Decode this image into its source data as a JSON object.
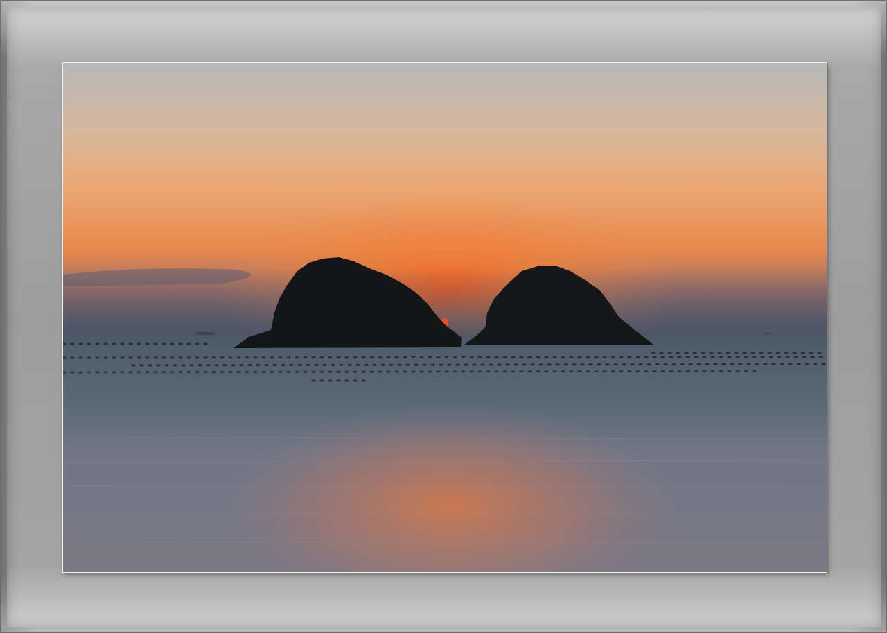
{
  "scene": {
    "subject": "two-islands-sunset",
    "colors": {
      "sky_top": "#b7b6b3",
      "sky_mid": "#e8b082",
      "sky_glow": "#f0752a",
      "sky_haze": "#5b5f72",
      "sea_far": "#4f5e6d",
      "sea_near": "#7a7a85",
      "reflection": "#e07a45",
      "island": "#141516",
      "mat": "#9d9d9d"
    }
  }
}
